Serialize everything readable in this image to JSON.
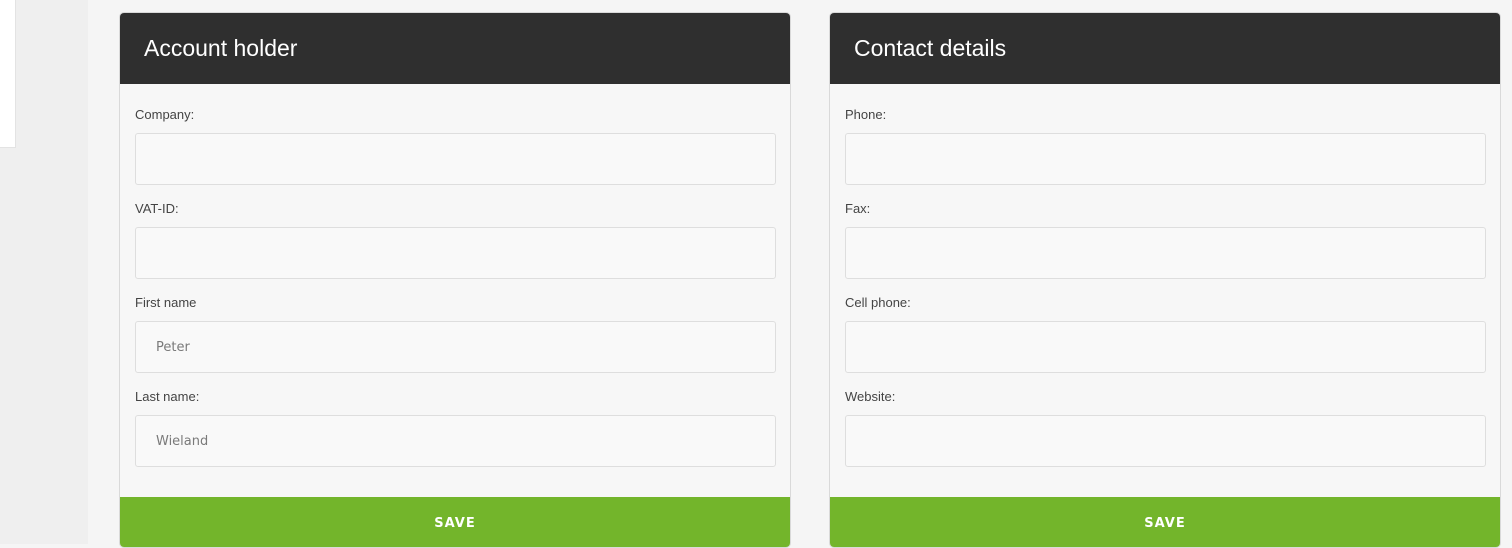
{
  "account_holder": {
    "title": "Account holder",
    "fields": [
      {
        "label": "Company:",
        "value": ""
      },
      {
        "label": "VAT-ID:",
        "value": ""
      },
      {
        "label": "First name",
        "value": "Peter"
      },
      {
        "label": "Last name:",
        "value": "Wieland"
      }
    ],
    "save_label": "SAVE"
  },
  "contact_details": {
    "title": "Contact details",
    "fields": [
      {
        "label": "Phone:",
        "value": ""
      },
      {
        "label": "Fax:",
        "value": ""
      },
      {
        "label": "Cell phone:",
        "value": ""
      },
      {
        "label": "Website:",
        "value": ""
      }
    ],
    "save_label": "SAVE"
  },
  "colors": {
    "header_bg": "#2f2f2f",
    "save_button_bg": "#73b52b",
    "panel_bg": "#f7f7f7"
  }
}
